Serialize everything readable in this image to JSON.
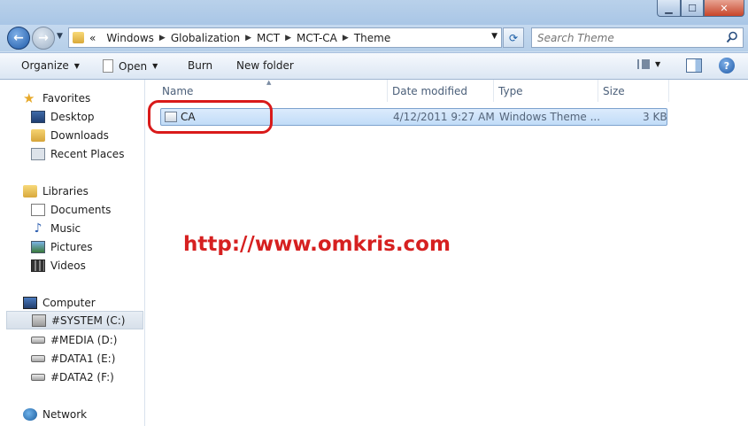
{
  "window": {
    "min_glyph": "▁",
    "max_glyph": "☐",
    "close_glyph": "✕"
  },
  "address": {
    "overflow": "«",
    "separator": "▶",
    "crumbs": [
      "Windows",
      "Globalization",
      "MCT",
      "MCT-CA",
      "Theme"
    ],
    "dropdown_glyph": "▼",
    "refresh_glyph": "⟳"
  },
  "search": {
    "placeholder": "Search Theme"
  },
  "toolbar": {
    "organize": "Organize",
    "open": "Open",
    "burn": "Burn",
    "new_folder": "New folder",
    "caret": "▼",
    "help": "?"
  },
  "nav": {
    "favorites": "Favorites",
    "desktop": "Desktop",
    "downloads": "Downloads",
    "recent_places": "Recent Places",
    "libraries": "Libraries",
    "documents": "Documents",
    "music": "Music",
    "pictures": "Pictures",
    "videos": "Videos",
    "computer": "Computer",
    "drives": [
      "#SYSTEM (C:)",
      "#MEDIA (D:)",
      "#DATA1 (E:)",
      "#DATA2 (F:)"
    ],
    "network": "Network"
  },
  "columns": {
    "name": "Name",
    "date": "Date modified",
    "type": "Type",
    "size": "Size"
  },
  "files": [
    {
      "name": "CA",
      "date": "4/12/2011 9:27 AM",
      "type": "Windows Theme ...",
      "size": "3 KB"
    }
  ],
  "watermark": "http://www.omkris.com",
  "colors": {
    "annotation": "#d91a1a",
    "selection": "#c1dcf8"
  }
}
